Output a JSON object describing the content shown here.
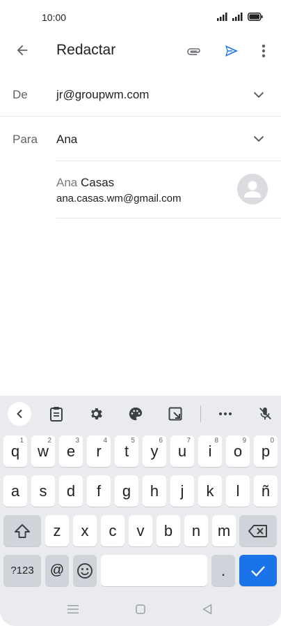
{
  "status": {
    "time": "10:00"
  },
  "app_bar": {
    "title": "Redactar"
  },
  "from": {
    "label": "De",
    "value": "jr@groupwm.com"
  },
  "to": {
    "label": "Para",
    "value": "Ana"
  },
  "suggestion": {
    "typed": "Ana",
    "rest": " Casas",
    "email": "ana.casas.wm@gmail.com"
  },
  "keyboard": {
    "row1": [
      {
        "k": "q",
        "h": "1"
      },
      {
        "k": "w",
        "h": "2"
      },
      {
        "k": "e",
        "h": "3"
      },
      {
        "k": "r",
        "h": "4"
      },
      {
        "k": "t",
        "h": "5"
      },
      {
        "k": "y",
        "h": "6"
      },
      {
        "k": "u",
        "h": "7"
      },
      {
        "k": "i",
        "h": "8"
      },
      {
        "k": "o",
        "h": "9"
      },
      {
        "k": "p",
        "h": "0"
      }
    ],
    "row2": [
      "a",
      "s",
      "d",
      "f",
      "g",
      "h",
      "j",
      "k",
      "l",
      "ñ"
    ],
    "row3": [
      "z",
      "x",
      "c",
      "v",
      "b",
      "n",
      "m"
    ],
    "symbols_label": "?123",
    "at_label": "@",
    "period_label": "."
  },
  "colors": {
    "accent": "#1a73e8",
    "keyboard_bg": "#e9ebef"
  }
}
